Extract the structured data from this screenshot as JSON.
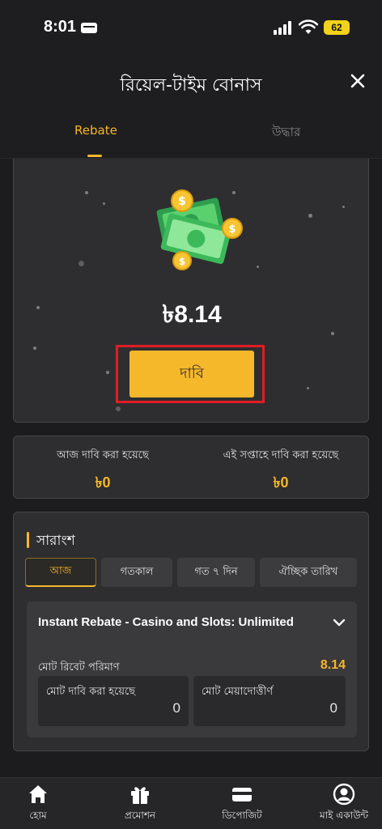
{
  "status_bar": {
    "time": "8:01",
    "battery": "62"
  },
  "header": {
    "title": "রিয়েল-টাইম বোনাস"
  },
  "tabs": [
    {
      "label": "Rebate"
    },
    {
      "label": "উদ্ধার"
    }
  ],
  "rebate": {
    "amount": "৳8.14",
    "claim_label": "দাবি"
  },
  "claimed": {
    "today_label": "আজ দাবি করা হয়েছে",
    "today_value": "৳0",
    "week_label": "এই সপ্তাহে দাবি করা হয়েছে",
    "week_value": "৳0"
  },
  "summary": {
    "title": "সারাংশ",
    "filters": [
      {
        "label": "আজ"
      },
      {
        "label": "গতকাল"
      },
      {
        "label": "গত ৭ দিন"
      },
      {
        "label": "ঐচ্ছিক তারিখ"
      }
    ],
    "active_filter": "আজ",
    "item": {
      "name": "Instant Rebate - Casino and Slots: Unlimited",
      "total_label": "মোট রিবেট পরিমাণ",
      "total_value": "8.14",
      "claimed_label": "মোট দাবি করা হয়েছে",
      "claimed_value": "0",
      "expired_label": "মোট মেয়াদোত্তীর্ণ",
      "expired_value": "0"
    }
  },
  "nav": [
    {
      "label": "হোম",
      "icon": "home-icon"
    },
    {
      "label": "প্রমোশন",
      "icon": "gift-icon"
    },
    {
      "label": "ডিপোজিট",
      "icon": "wallet-icon"
    },
    {
      "label": "মাই একাউন্ট",
      "icon": "account-icon"
    }
  ],
  "colors": {
    "accent": "#f5b72b",
    "background": "#1c1c1e",
    "card": "#2e2e30",
    "highlight_outline": "#e01d25"
  }
}
